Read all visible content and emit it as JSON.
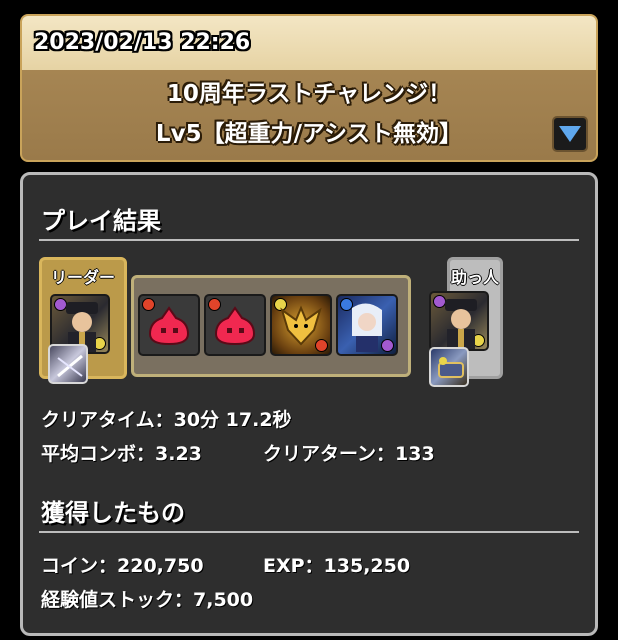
{
  "header": {
    "datetime": "2023/02/13 22:26",
    "dungeon_title": "10周年ラストチャレンジ！",
    "dungeon_level": "Lv5【超重力/アシスト無効】",
    "dropdown_icon": "triangle-down-icon",
    "accent_color": "#5fa8ee"
  },
  "result": {
    "title": "プレイ結果",
    "leader_label": "リーダー",
    "friend_label": "助っ人",
    "team": {
      "leader": {
        "icon": "leader-monster-icon",
        "assist_icon": "leader-assist-icon"
      },
      "subs": [
        {
          "icon": "red-slime-icon"
        },
        {
          "icon": "red-slime-icon"
        },
        {
          "icon": "golden-dragon-icon"
        },
        {
          "icon": "white-haired-girl-icon"
        }
      ],
      "friend": {
        "icon": "friend-monster-icon",
        "assist_icon": "friend-assist-icon"
      }
    },
    "clear_time": "クリアタイム：30分 17.2秒",
    "avg_combo": "平均コンボ：3.23",
    "clear_turns": "クリアターン：133"
  },
  "rewards": {
    "title": "獲得したもの",
    "coins": "コイン：220,750",
    "exp": "EXP：135,250",
    "exp_stock": "経験値ストック：7,500"
  }
}
